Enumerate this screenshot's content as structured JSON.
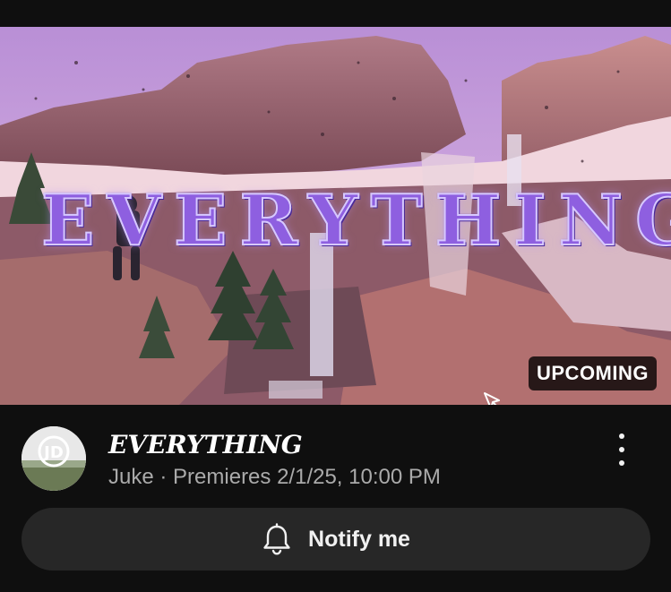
{
  "video": {
    "thumbnail_text": "EVERYTHING",
    "badge": "UPCOMING",
    "title": "EVERYTHING",
    "channel": "Juke",
    "separator": "·",
    "schedule": "Premieres 2/1/25, 10:00 PM",
    "avatar_text": "JD"
  },
  "actions": {
    "notify_label": "Notify me",
    "more_icon": "more-vertical-icon",
    "bell_icon": "bell-icon"
  },
  "colors": {
    "background": "#0f0f0f",
    "button": "#272727",
    "secondary_text": "#aaaaaa",
    "thumbnail_title": "#8e5fe0"
  }
}
